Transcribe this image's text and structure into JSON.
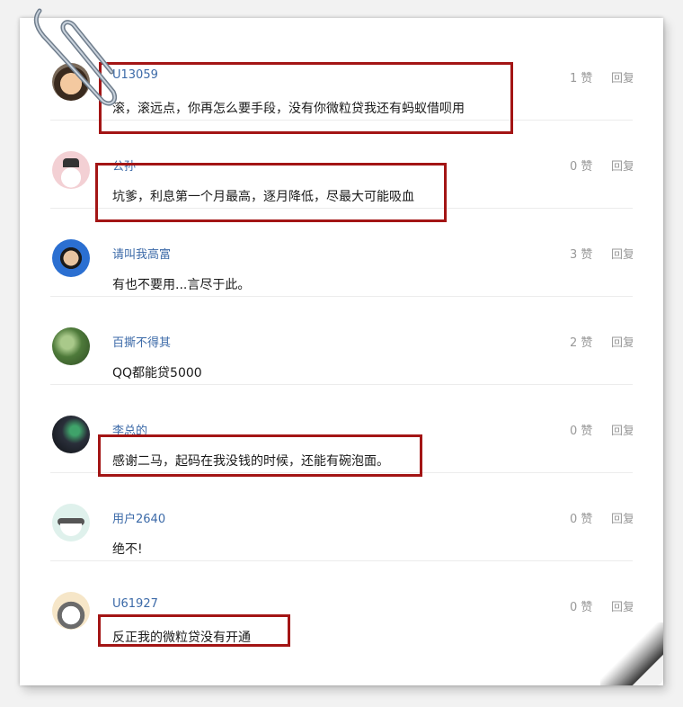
{
  "comments": [
    {
      "user": "U13059",
      "text": "滚，滚远点，你再怎么要手段，没有你微粒贷我还有蚂蚁借呗用",
      "likes": "1 赞",
      "reply": "回复",
      "avatar": "child-photo-avatar",
      "highlighted": true
    },
    {
      "user": "公孙",
      "text": "坑爹，利息第一个月最高，逐月降低，尽最大可能吸血",
      "likes": "0 赞",
      "reply": "回复",
      "avatar": "cartoon-dog-avatar",
      "highlighted": true
    },
    {
      "user": "请叫我高富",
      "text": "有也不要用...言尽于此。",
      "likes": "3 赞",
      "reply": "回复",
      "avatar": "person-photo-avatar",
      "highlighted": false
    },
    {
      "user": "百撕不得其",
      "text": "QQ都能贷5000",
      "likes": "2 赞",
      "reply": "回复",
      "avatar": "forest-photo-avatar",
      "highlighted": false
    },
    {
      "user": "李总的",
      "text": "感谢二马，起码在我没钱的时候，还能有碗泡面。",
      "likes": "0 赞",
      "reply": "回复",
      "avatar": "dark-game-avatar",
      "highlighted": true
    },
    {
      "user": "用户2640",
      "text": "绝不!",
      "likes": "0 赞",
      "reply": "回复",
      "avatar": "masked-cartoon-avatar",
      "highlighted": false
    },
    {
      "user": "U61927",
      "text": "反正我的微粒贷没有开通",
      "likes": "0 赞",
      "reply": "回复",
      "avatar": "husky-cartoon-avatar",
      "highlighted": true
    }
  ],
  "colors": {
    "username": "#3c6aa8",
    "highlight_box": "#a31515",
    "meta": "#999999"
  }
}
